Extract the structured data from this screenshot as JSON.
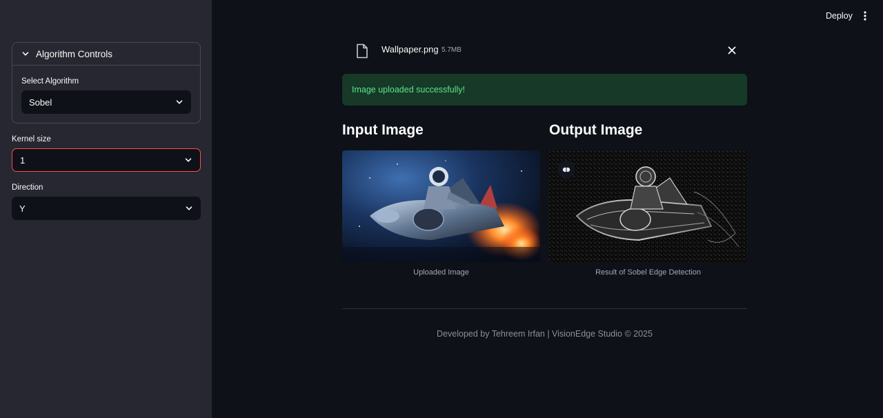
{
  "header": {
    "deploy_label": "Deploy"
  },
  "sidebar": {
    "expander_title": "Algorithm Controls",
    "select_algorithm_label": "Select Algorithm",
    "select_algorithm_value": "Sobel",
    "kernel_label": "Kernel size",
    "kernel_value": "1",
    "direction_label": "Direction",
    "direction_value": "Y"
  },
  "file": {
    "name": "Wallpaper.png",
    "size": "5.7MB"
  },
  "alert": {
    "text": "Image uploaded successfully!"
  },
  "input": {
    "heading": "Input Image",
    "caption": "Uploaded Image"
  },
  "output": {
    "heading": "Output Image",
    "caption": "Result of Sobel Edge Detection"
  },
  "footer": {
    "text": "Developed by Tehreem Irfan | VisionEdge Studio © 2025"
  },
  "colors": {
    "sidebar_bg": "#262730",
    "main_bg": "#0e1117",
    "success_bg": "#173928",
    "success_text": "#5ce488",
    "kernel_border": "#ff4b4b"
  }
}
